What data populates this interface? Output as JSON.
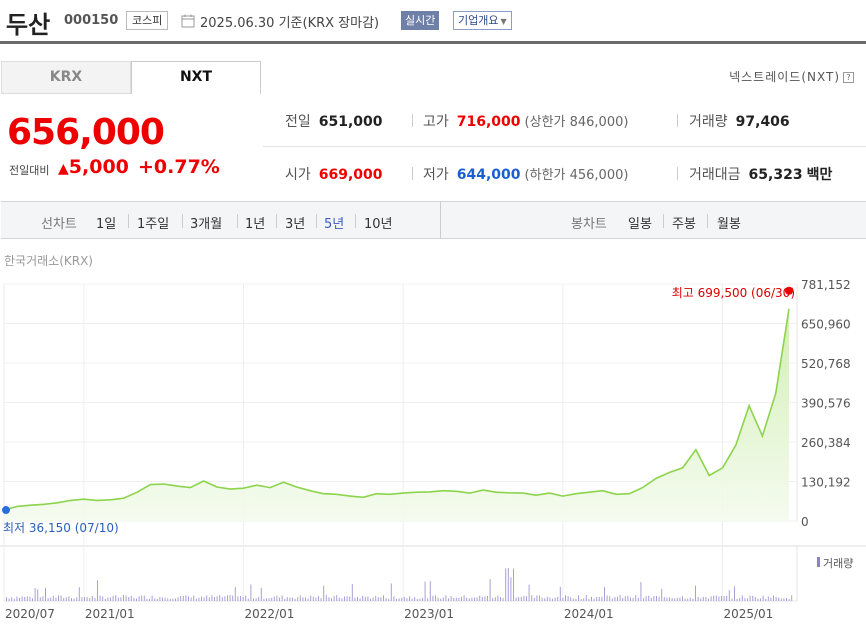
{
  "header": {
    "name": "두산",
    "code": "000150",
    "market": "코스피",
    "date": "2025.06.30",
    "basis": "기준(KRX 장마감)",
    "realtime": "실시간",
    "company_overview": "기업개요"
  },
  "tabs": {
    "krx": "KRX",
    "nxt": "NXT"
  },
  "nxt_link": "넥스트레이드(NXT)",
  "nxt_help": "?",
  "price": {
    "current": "656,000",
    "change_label": "전일대비",
    "change_arrow": "▲",
    "change": "5,000",
    "change_rate": "+0.77%"
  },
  "stats": {
    "prev_label": "전일",
    "prev": "651,000",
    "high_label": "고가",
    "high": "716,000",
    "upper_limit": "(상한가 846,000)",
    "volume_label": "거래량",
    "volume": "97,406",
    "open_label": "시가",
    "open": "669,000",
    "low_label": "저가",
    "low": "644,000",
    "lower_limit": "(하한가 456,000)",
    "amount_label": "거래대금",
    "amount": "65,323",
    "amount_unit": "백만"
  },
  "period_bar": {
    "line_label": "선차트",
    "line_items": [
      "1일",
      "1주일",
      "3개월",
      "1년",
      "3년",
      "5년",
      "10년"
    ],
    "active": "5년",
    "candle_label": "봉차트",
    "candle_items": [
      "일봉",
      "주봉",
      "월봉"
    ]
  },
  "exchange_label": "한국거래소(KRX)",
  "colors": {
    "up": "#e00000",
    "down": "#1a5fd2",
    "line": "#8bd44c",
    "fill": "#dff2c8",
    "volume": "#8f80c9"
  },
  "chart_data": {
    "type": "area",
    "y_ticks": [
      "781,152",
      "650,960",
      "520,768",
      "390,576",
      "260,384",
      "130,192",
      "0"
    ],
    "ylim": [
      0,
      781152
    ],
    "x_ticks": [
      "2020/07",
      "2021/01",
      "2022/01",
      "2023/01",
      "2024/01",
      "2025/01"
    ],
    "max_label": "최고 699,500 (06/30)",
    "min_label": "최저 36,150 (07/10)",
    "volume_legend": "거래량",
    "x": [
      "2020/07",
      "2020/08",
      "2020/09",
      "2020/10",
      "2020/11",
      "2020/12",
      "2021/01",
      "2021/02",
      "2021/03",
      "2021/04",
      "2021/05",
      "2021/06",
      "2021/07",
      "2021/08",
      "2021/09",
      "2021/10",
      "2021/11",
      "2021/12",
      "2022/01",
      "2022/02",
      "2022/03",
      "2022/04",
      "2022/05",
      "2022/06",
      "2022/07",
      "2022/08",
      "2022/09",
      "2022/10",
      "2022/11",
      "2022/12",
      "2023/01",
      "2023/02",
      "2023/03",
      "2023/04",
      "2023/05",
      "2023/06",
      "2023/07",
      "2023/08",
      "2023/09",
      "2023/10",
      "2023/11",
      "2023/12",
      "2024/01",
      "2024/02",
      "2024/03",
      "2024/04",
      "2024/05",
      "2024/06",
      "2024/07",
      "2024/08",
      "2024/09",
      "2024/10",
      "2024/11",
      "2024/12",
      "2025/01",
      "2025/02",
      "2025/03",
      "2025/04",
      "2025/05",
      "2025/06"
    ],
    "values": [
      36150,
      48000,
      52000,
      55000,
      60000,
      68000,
      72000,
      68000,
      70000,
      75000,
      95000,
      120000,
      122000,
      115000,
      110000,
      132000,
      112000,
      105000,
      108000,
      118000,
      110000,
      128000,
      112000,
      100000,
      90000,
      88000,
      82000,
      78000,
      90000,
      88000,
      92000,
      95000,
      96000,
      100000,
      98000,
      92000,
      102000,
      95000,
      93000,
      92000,
      85000,
      92000,
      82000,
      90000,
      95000,
      100000,
      88000,
      90000,
      110000,
      140000,
      160000,
      175000,
      235000,
      150000,
      175000,
      250000,
      380000,
      280000,
      420000,
      699500
    ]
  }
}
